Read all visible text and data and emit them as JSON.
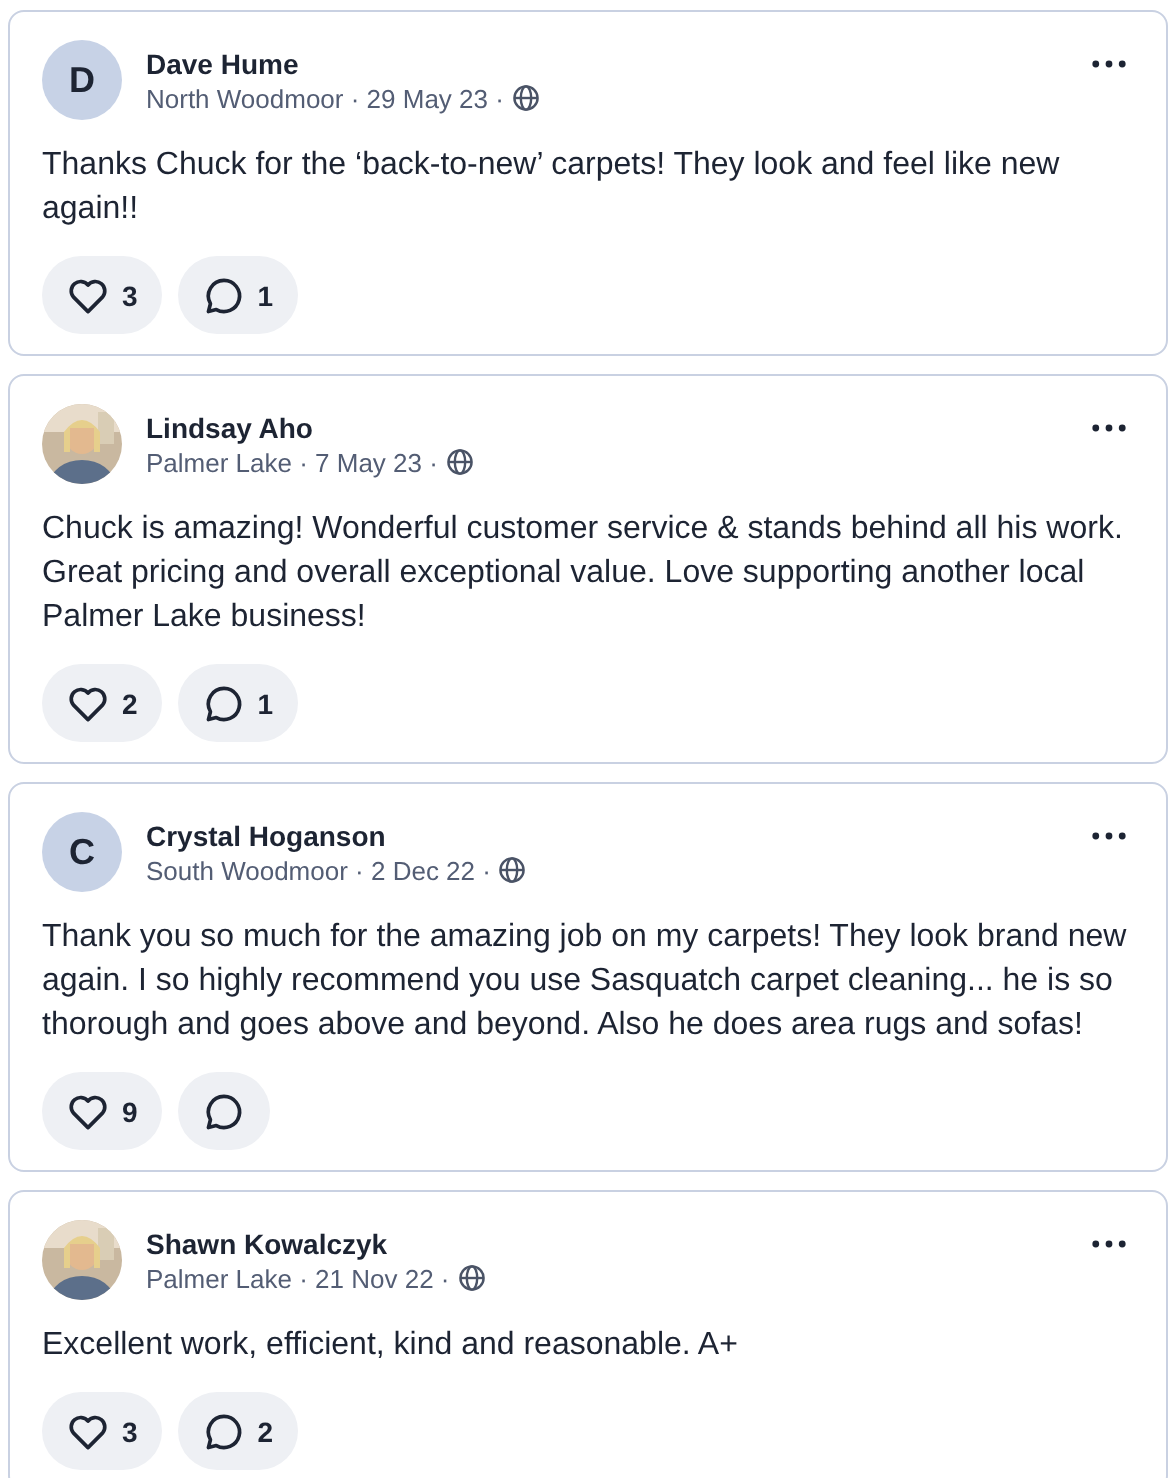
{
  "posts": [
    {
      "author": "Dave Hume",
      "avatar": {
        "kind": "initial",
        "initial": "D"
      },
      "meta": "North Woodmoor · 29 May 23 ·",
      "text": "Thanks Chuck for the ‘back-to-new’ carpets!  They look and feel like new again!!",
      "likes": "3",
      "comments": "1"
    },
    {
      "author": "Lindsay Aho",
      "meta": "Palmer Lake · 7 May 23 ·",
      "text": "Chuck is amazing! Wonderful customer service & stands behind all his work. Great pricing and overall exceptional value. Love supporting another local Palmer Lake business!",
      "likes": "2",
      "comments": "1"
    },
    {
      "author": "Crystal Hoganson",
      "avatar": {
        "kind": "initial",
        "initial": "C"
      },
      "meta": "South Woodmoor · 2 Dec 22 ·",
      "text": "Thank you so much for the amazing job on my carpets! They look brand new again. I so highly recommend you use Sasquatch carpet cleaning... he is so thorough and goes above and beyond.  Also he does area rugs and sofas!",
      "likes": "9"
    },
    {
      "author": "Shawn Kowalczyk",
      "meta": "Palmer Lake · 21 Nov 22 ·",
      "text": "Excellent work, efficient, kind and reasonable.  A+",
      "likes": "3",
      "comments": "2"
    }
  ]
}
